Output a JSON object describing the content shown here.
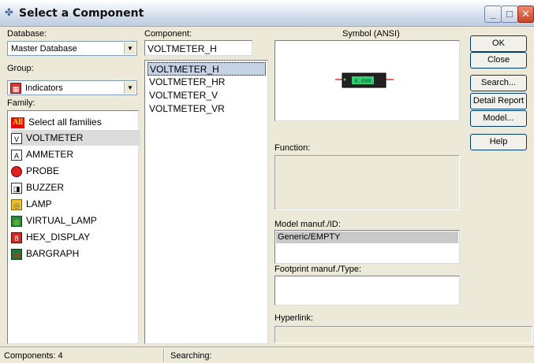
{
  "window": {
    "title": "Select a Component"
  },
  "database": {
    "label": "Database:",
    "selected": "Master Database"
  },
  "group": {
    "label": "Group:",
    "selected": "Indicators"
  },
  "family": {
    "label": "Family:",
    "items": [
      {
        "label": "Select all families",
        "icon": "all-families-icon"
      },
      {
        "label": "VOLTMETER",
        "icon": "voltmeter-icon"
      },
      {
        "label": "AMMETER",
        "icon": "ammeter-icon"
      },
      {
        "label": "PROBE",
        "icon": "probe-icon"
      },
      {
        "label": "BUZZER",
        "icon": "buzzer-icon"
      },
      {
        "label": "LAMP",
        "icon": "lamp-icon"
      },
      {
        "label": "VIRTUAL_LAMP",
        "icon": "virtual-lamp-icon"
      },
      {
        "label": "HEX_DISPLAY",
        "icon": "hex-display-icon"
      },
      {
        "label": "BARGRAPH",
        "icon": "bargraph-icon"
      }
    ],
    "all_badge": "All"
  },
  "component": {
    "label": "Component:",
    "value": "VOLTMETER_H",
    "items": [
      "VOLTMETER_H",
      "VOLTMETER_HR",
      "VOLTMETER_V",
      "VOLTMETER_VR"
    ]
  },
  "symbol": {
    "label": "Symbol (ANSI)",
    "readout": "0.000"
  },
  "function": {
    "label": "Function:"
  },
  "model": {
    "label": "Model manuf./ID:",
    "items": [
      "Generic/EMPTY"
    ]
  },
  "footprint": {
    "label": "Footprint manuf./Type:"
  },
  "hyperlink": {
    "label": "Hyperlink:"
  },
  "buttons": {
    "ok": "OK",
    "close": "Close",
    "search": "Search...",
    "detail_report": "Detail Report",
    "model": "Model...",
    "help": "Help"
  },
  "status": {
    "components": "Components: 4",
    "searching": "Searching:"
  },
  "colors": {
    "selection": "#c6d3e6",
    "title_close": "#c8432a",
    "symbol_green": "#2fd070"
  }
}
